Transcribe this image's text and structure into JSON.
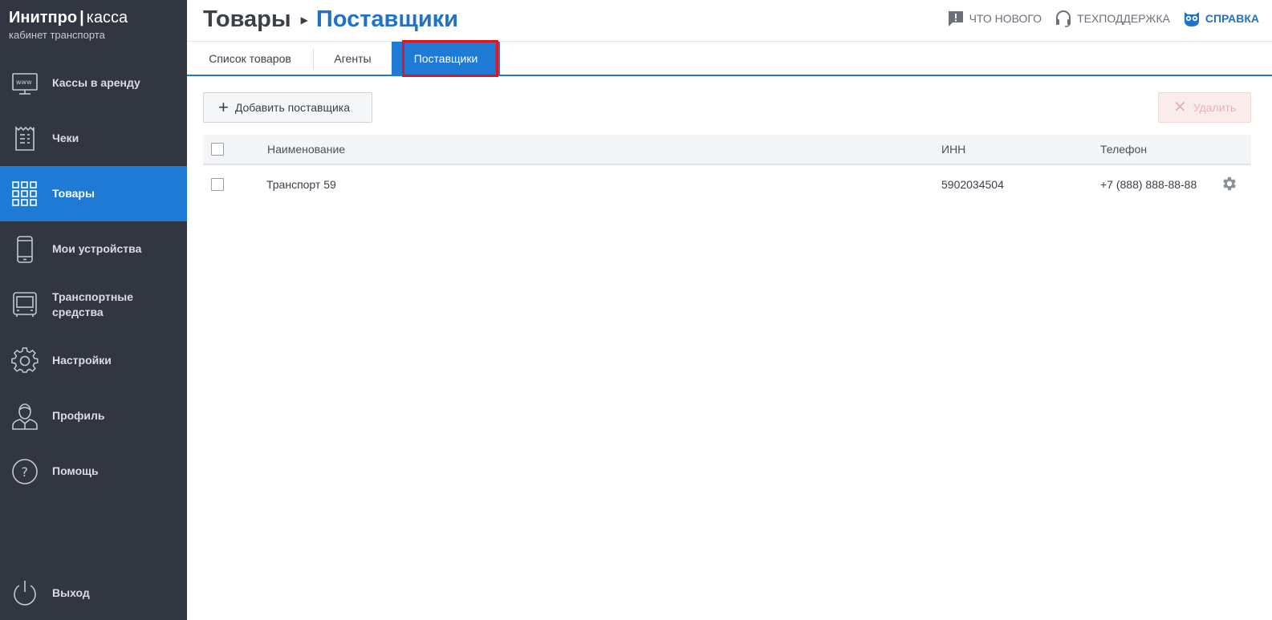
{
  "brand": {
    "name_bold": "Инитпро",
    "separator": "|",
    "name_light": "касса",
    "subtitle": "кабинет транспорта"
  },
  "sidebar": {
    "items": [
      {
        "label": "Кассы в аренду",
        "icon": "www-monitor-icon"
      },
      {
        "label": "Чеки",
        "icon": "receipt-icon"
      },
      {
        "label": "Товары",
        "icon": "grid-icon",
        "active": true
      },
      {
        "label": "Мои устройства",
        "icon": "phone-icon"
      },
      {
        "label": "Транспортные средства",
        "icon": "bus-icon"
      },
      {
        "label": "Настройки",
        "icon": "gear-icon"
      },
      {
        "label": "Профиль",
        "icon": "user-icon"
      },
      {
        "label": "Помощь",
        "icon": "question-icon"
      },
      {
        "label": "Выход",
        "icon": "power-icon"
      }
    ]
  },
  "header": {
    "breadcrumb_parent": "Товары",
    "breadcrumb_current": "Поставщики",
    "links": {
      "whats_new": "ЧТО НОВОГО",
      "support": "ТЕХПОДДЕРЖКА",
      "help": "СПРАВКА"
    }
  },
  "tabs": [
    {
      "label": "Список товаров"
    },
    {
      "label": "Агенты"
    },
    {
      "label": "Поставщики",
      "active": true
    }
  ],
  "toolbar": {
    "add_label": "Добавить поставщика",
    "delete_label": "Удалить"
  },
  "table": {
    "columns": [
      "Наименование",
      "ИНН",
      "Телефон"
    ],
    "rows": [
      {
        "name": "Транспорт 59",
        "inn": "5902034504",
        "phone": "+7 (888) 888-88-88"
      }
    ]
  },
  "colors": {
    "sidebar_bg": "#313640",
    "accent": "#1f7ad6",
    "highlight": "#e0151f"
  }
}
